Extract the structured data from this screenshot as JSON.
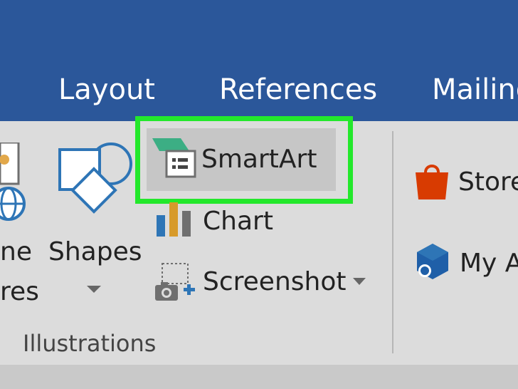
{
  "tabs": [
    "Layout",
    "References",
    "Mailing"
  ],
  "illustrations": {
    "pictures_label_line1": "ne",
    "pictures_label_line2": "res",
    "shapes_label": "Shapes",
    "smartart_label": "SmartArt",
    "chart_label": "Chart",
    "screenshot_label": "Screenshot",
    "group_label": "Illustrations"
  },
  "addins": {
    "store_label": "Store",
    "my_addins_label": "My A"
  },
  "highlight_color": "#23e82b",
  "ribbon_tab_color": "#2b579a",
  "icons": [
    "pictures-icon",
    "online-pictures-icon",
    "shapes-icon",
    "smartart-icon",
    "chart-icon",
    "screenshot-icon",
    "store-icon",
    "my-addins-icon",
    "dropdown-arrow-icon"
  ]
}
